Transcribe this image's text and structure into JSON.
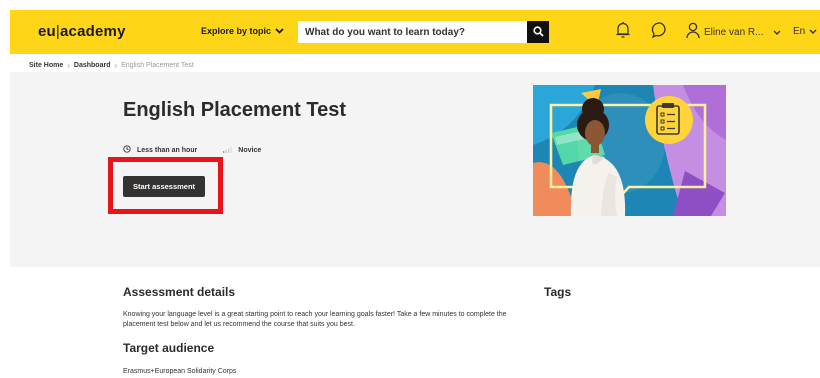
{
  "header": {
    "logo_left": "eu",
    "logo_right": "academy",
    "explore_label": "Explore by topic",
    "search_placeholder": "What do you want to learn today?",
    "user_name": "Eline van R...",
    "language": "En"
  },
  "breadcrumb": {
    "items": [
      "Site Home",
      "Dashboard"
    ],
    "current": "English Placement Test"
  },
  "course": {
    "title": "English Placement Test",
    "duration": "Less than an hour",
    "level": "Novice",
    "start_label": "Start assessment"
  },
  "details": {
    "heading": "Assessment details",
    "description": "Knowing your language level is a great starting point to reach your learning goals faster! Take a few minutes to complete the placement test below and let us recommend the course that suits you best.",
    "audience_heading": "Target audience",
    "audience": "Erasmus+European Solidarity Corps",
    "tags_heading": "Tags"
  },
  "colors": {
    "brand_yellow": "#ffd617",
    "button_dark": "#333333",
    "highlight_red": "#e8141b",
    "hero_bg": "#f4f4f4"
  },
  "icons": [
    "chevron-down-icon",
    "search-icon",
    "bell-icon",
    "chat-icon",
    "user-icon",
    "clock-icon",
    "signal-icon",
    "checklist-icon"
  ]
}
